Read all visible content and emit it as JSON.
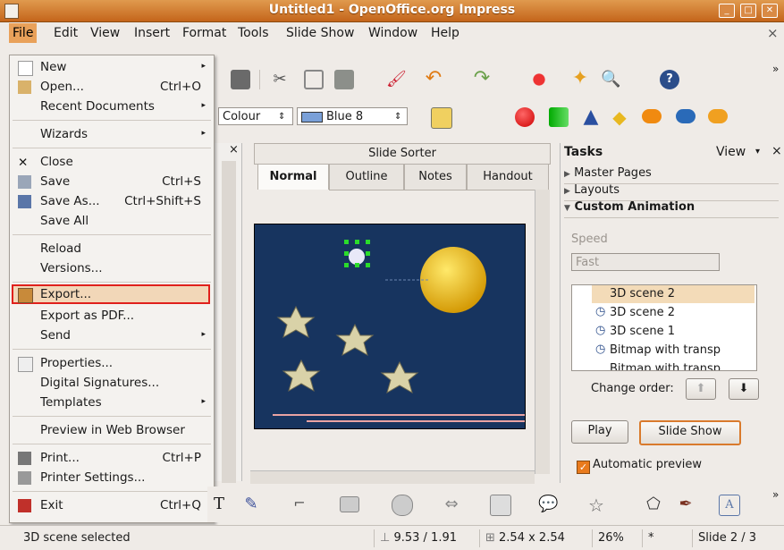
{
  "window": {
    "title": "Untitled1 - OpenOffice.org Impress"
  },
  "menubar": [
    "File",
    "Edit",
    "View",
    "Insert",
    "Format",
    "Tools",
    "Slide Show",
    "Window",
    "Help"
  ],
  "file_menu": {
    "new": "New",
    "open": "Open...",
    "open_sc": "Ctrl+O",
    "recent": "Recent Documents",
    "wizards": "Wizards",
    "close": "Close",
    "save": "Save",
    "save_sc": "Ctrl+S",
    "save_as": "Save As...",
    "save_as_sc": "Ctrl+Shift+S",
    "save_all": "Save All",
    "reload": "Reload",
    "versions": "Versions...",
    "export": "Export...",
    "export_pdf": "Export as PDF...",
    "send": "Send",
    "properties": "Properties...",
    "digital_signatures": "Digital Signatures...",
    "templates": "Templates",
    "preview_web": "Preview in Web Browser",
    "print": "Print...",
    "print_sc": "Ctrl+P",
    "printer_settings": "Printer Settings...",
    "exit": "Exit",
    "exit_sc": "Ctrl+Q"
  },
  "line_toolbar": {
    "area_style": "Colour",
    "color_name": "Blue 8",
    "color": "#1b3b87"
  },
  "views": {
    "slide_sorter": "Slide Sorter",
    "tabs": [
      "Normal",
      "Outline",
      "Notes",
      "Handout"
    ],
    "active": "Normal"
  },
  "tasks": {
    "title": "Tasks",
    "view_label": "View",
    "sections": [
      "Master Pages",
      "Layouts",
      "Custom Animation"
    ],
    "speed_label": "Speed",
    "speed_value": "Fast",
    "animations": [
      "3D scene 2",
      "3D scene 2",
      "3D scene 1",
      "Bitmap with transp",
      "Bitmap with transp"
    ],
    "change_order": "Change order:",
    "play": "Play",
    "slide_show": "Slide Show",
    "auto_preview": "Automatic preview"
  },
  "status": {
    "selection": "3D scene selected",
    "position": "9.53 / 1.91",
    "size": "2.54 x 2.54",
    "zoom": "26%",
    "modified": "*",
    "slide": "Slide 2 / 3"
  },
  "colors": {
    "accent": "#e9a15a",
    "slide_bg": "#17345f",
    "highlight_box": "#e0201c"
  }
}
